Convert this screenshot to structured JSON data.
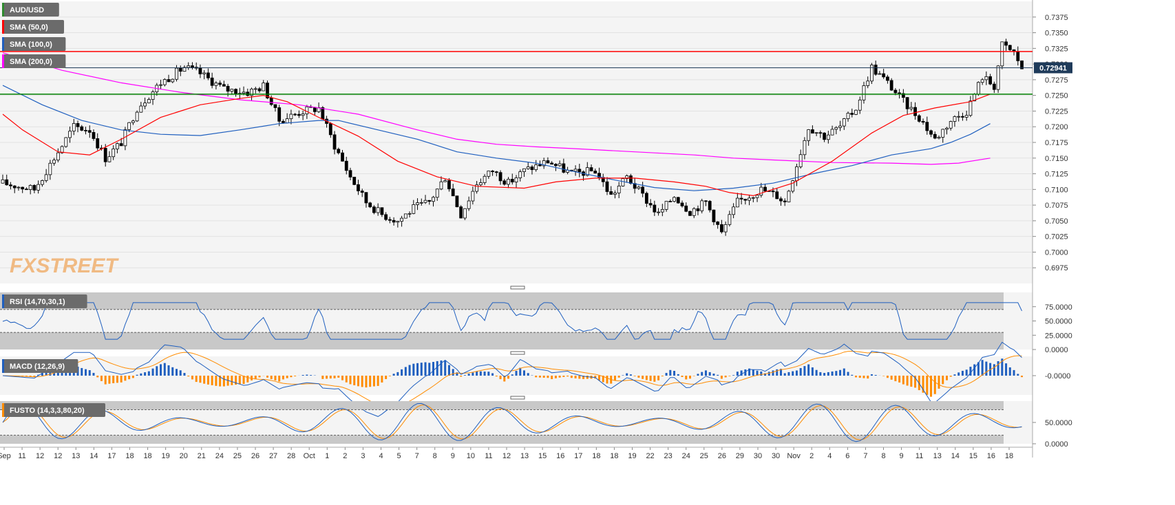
{
  "chart_data": {
    "type": "candlestick",
    "symbol": "AUD/USD",
    "watermark": "FXSTREET",
    "colors": {
      "background": "#f4f4f4",
      "candle_up": "#ffffff",
      "candle_down": "#000000",
      "sma50": "#ff0000",
      "sma100": "#1f5fbf",
      "sma200": "#ff00ff",
      "resistance": "#ff0000",
      "support": "#008000",
      "price_line": "#1f3b5a",
      "rsi": "#1f5fbf",
      "macd": "#1f5fbf",
      "signal": "#ff8c00",
      "hist_pos": "#1f5fbf",
      "hist_neg": "#ff8c00",
      "osc_band": "#c8c8c8",
      "legend_bg": "#6b6b6b"
    },
    "legend": [
      {
        "label": "AUD/USD",
        "color": "#2e8b2e"
      },
      {
        "label": "SMA (50,0)",
        "color": "#ff0000"
      },
      {
        "label": "SMA (100,0)",
        "color": "#1f5fbf"
      },
      {
        "label": "SMA (200,0)",
        "color": "#ff00ff"
      }
    ],
    "price_axis": {
      "min": 0.695,
      "max": 0.74,
      "ticks": [
        "0.7375",
        "0.7350",
        "0.7325",
        "0.7300",
        "0.7275",
        "0.7250",
        "0.7225",
        "0.7200",
        "0.7175",
        "0.7150",
        "0.7125",
        "0.7100",
        "0.7075",
        "0.7050",
        "0.7025",
        "0.7000",
        "0.6975"
      ],
      "current_price": "0.72941",
      "current_value": 0.72941
    },
    "levels": {
      "resistance": 0.732,
      "support": 0.7252
    },
    "x_labels": [
      "Sep",
      "11",
      "12",
      "12",
      "13",
      "14",
      "17",
      "18",
      "18",
      "19",
      "20",
      "21",
      "24",
      "25",
      "26",
      "27",
      "28",
      "Oct",
      "1",
      "2",
      "3",
      "4",
      "5",
      "7",
      "8",
      "9",
      "10",
      "11",
      "12",
      "13",
      "15",
      "16",
      "17",
      "18",
      "18",
      "19",
      "22",
      "23",
      "24",
      "25",
      "26",
      "29",
      "30",
      "30",
      "Nov",
      "2",
      "4",
      "6",
      "7",
      "8",
      "9",
      "11",
      "13",
      "14",
      "15",
      "16",
      "18"
    ],
    "sma50_path": [
      [
        0,
        0.722
      ],
      [
        5,
        0.7195
      ],
      [
        14,
        0.716
      ],
      [
        22,
        0.7155
      ],
      [
        30,
        0.718
      ],
      [
        40,
        0.7215
      ],
      [
        50,
        0.7235
      ],
      [
        60,
        0.7245
      ],
      [
        66,
        0.725
      ],
      [
        72,
        0.724
      ],
      [
        80,
        0.7215
      ],
      [
        90,
        0.7185
      ],
      [
        100,
        0.7145
      ],
      [
        110,
        0.712
      ],
      [
        120,
        0.7105
      ],
      [
        132,
        0.7102
      ],
      [
        140,
        0.7112
      ],
      [
        150,
        0.7118
      ],
      [
        160,
        0.7118
      ],
      [
        170,
        0.7112
      ],
      [
        178,
        0.7105
      ],
      [
        184,
        0.7095
      ],
      [
        190,
        0.709
      ],
      [
        200,
        0.711
      ],
      [
        210,
        0.7145
      ],
      [
        220,
        0.719
      ],
      [
        228,
        0.7218
      ],
      [
        236,
        0.723
      ],
      [
        245,
        0.724
      ],
      [
        250,
        0.7252
      ]
    ],
    "sma100_path": [
      [
        0,
        0.7266
      ],
      [
        10,
        0.7235
      ],
      [
        20,
        0.721
      ],
      [
        30,
        0.7195
      ],
      [
        40,
        0.7188
      ],
      [
        50,
        0.7186
      ],
      [
        60,
        0.7195
      ],
      [
        70,
        0.7205
      ],
      [
        80,
        0.721
      ],
      [
        85,
        0.721
      ],
      [
        95,
        0.7195
      ],
      [
        105,
        0.718
      ],
      [
        115,
        0.716
      ],
      [
        125,
        0.715
      ],
      [
        135,
        0.7142
      ],
      [
        145,
        0.7128
      ],
      [
        155,
        0.7115
      ],
      [
        165,
        0.7103
      ],
      [
        175,
        0.7098
      ],
      [
        185,
        0.7102
      ],
      [
        195,
        0.711
      ],
      [
        205,
        0.7125
      ],
      [
        215,
        0.7138
      ],
      [
        225,
        0.7155
      ],
      [
        235,
        0.7165
      ],
      [
        240,
        0.7175
      ],
      [
        245,
        0.7188
      ],
      [
        250,
        0.7205
      ]
    ],
    "sma200_path": [
      [
        0,
        0.7318
      ],
      [
        15,
        0.729
      ],
      [
        30,
        0.727
      ],
      [
        45,
        0.7255
      ],
      [
        60,
        0.7243
      ],
      [
        75,
        0.7235
      ],
      [
        90,
        0.722
      ],
      [
        105,
        0.7195
      ],
      [
        115,
        0.718
      ],
      [
        125,
        0.7172
      ],
      [
        135,
        0.7168
      ],
      [
        145,
        0.7165
      ],
      [
        160,
        0.716
      ],
      [
        175,
        0.7155
      ],
      [
        185,
        0.715
      ],
      [
        195,
        0.7147
      ],
      [
        210,
        0.7143
      ],
      [
        225,
        0.7142
      ],
      [
        235,
        0.714
      ],
      [
        242,
        0.7142
      ],
      [
        250,
        0.715
      ]
    ],
    "key_points": [
      [
        0,
        0.711
      ],
      [
        8,
        0.71
      ],
      [
        14,
        0.716
      ],
      [
        18,
        0.72
      ],
      [
        22,
        0.7195
      ],
      [
        26,
        0.715
      ],
      [
        30,
        0.7175
      ],
      [
        34,
        0.723
      ],
      [
        40,
        0.727
      ],
      [
        46,
        0.7295
      ],
      [
        50,
        0.7285
      ],
      [
        56,
        0.726
      ],
      [
        62,
        0.7255
      ],
      [
        66,
        0.7265
      ],
      [
        70,
        0.721
      ],
      [
        76,
        0.7225
      ],
      [
        80,
        0.723
      ],
      [
        84,
        0.717
      ],
      [
        88,
        0.712
      ],
      [
        92,
        0.708
      ],
      [
        96,
        0.706
      ],
      [
        100,
        0.705
      ],
      [
        104,
        0.707
      ],
      [
        108,
        0.708
      ],
      [
        112,
        0.712
      ],
      [
        116,
        0.706
      ],
      [
        120,
        0.711
      ],
      [
        124,
        0.713
      ],
      [
        128,
        0.711
      ],
      [
        132,
        0.713
      ],
      [
        138,
        0.7145
      ],
      [
        144,
        0.7125
      ],
      [
        150,
        0.713
      ],
      [
        154,
        0.709
      ],
      [
        158,
        0.712
      ],
      [
        162,
        0.709
      ],
      [
        166,
        0.706
      ],
      [
        170,
        0.709
      ],
      [
        174,
        0.7065
      ],
      [
        178,
        0.708
      ],
      [
        182,
        0.703
      ],
      [
        186,
        0.708
      ],
      [
        192,
        0.71
      ],
      [
        196,
        0.709
      ],
      [
        198,
        0.708
      ],
      [
        200,
        0.712
      ],
      [
        204,
        0.72
      ],
      [
        208,
        0.7185
      ],
      [
        212,
        0.72
      ],
      [
        216,
        0.723
      ],
      [
        220,
        0.7295
      ],
      [
        224,
        0.727
      ],
      [
        228,
        0.724
      ],
      [
        232,
        0.7215
      ],
      [
        236,
        0.718
      ],
      [
        240,
        0.721
      ],
      [
        244,
        0.7225
      ],
      [
        248,
        0.728
      ],
      [
        251,
        0.7265
      ],
      [
        253,
        0.733
      ],
      [
        256,
        0.7318
      ],
      [
        258,
        0.7294
      ]
    ],
    "rsi": {
      "label": "RSI (14,70,30,1)",
      "min": 0,
      "max": 100,
      "overbought": 70,
      "oversold": 30,
      "ticks": [
        "75.0000",
        "50.0000",
        "25.0000",
        "0.0000"
      ],
      "last": 55
    },
    "macd": {
      "label": "MACD (12,26,9)",
      "ticks": [
        "-0.0000"
      ]
    },
    "fusto": {
      "label": "FUSTO (14,3,3,80,20)",
      "min": 0,
      "max": 100,
      "overbought": 80,
      "oversold": 20,
      "ticks": [
        "50.0000",
        "0.0000"
      ]
    }
  }
}
